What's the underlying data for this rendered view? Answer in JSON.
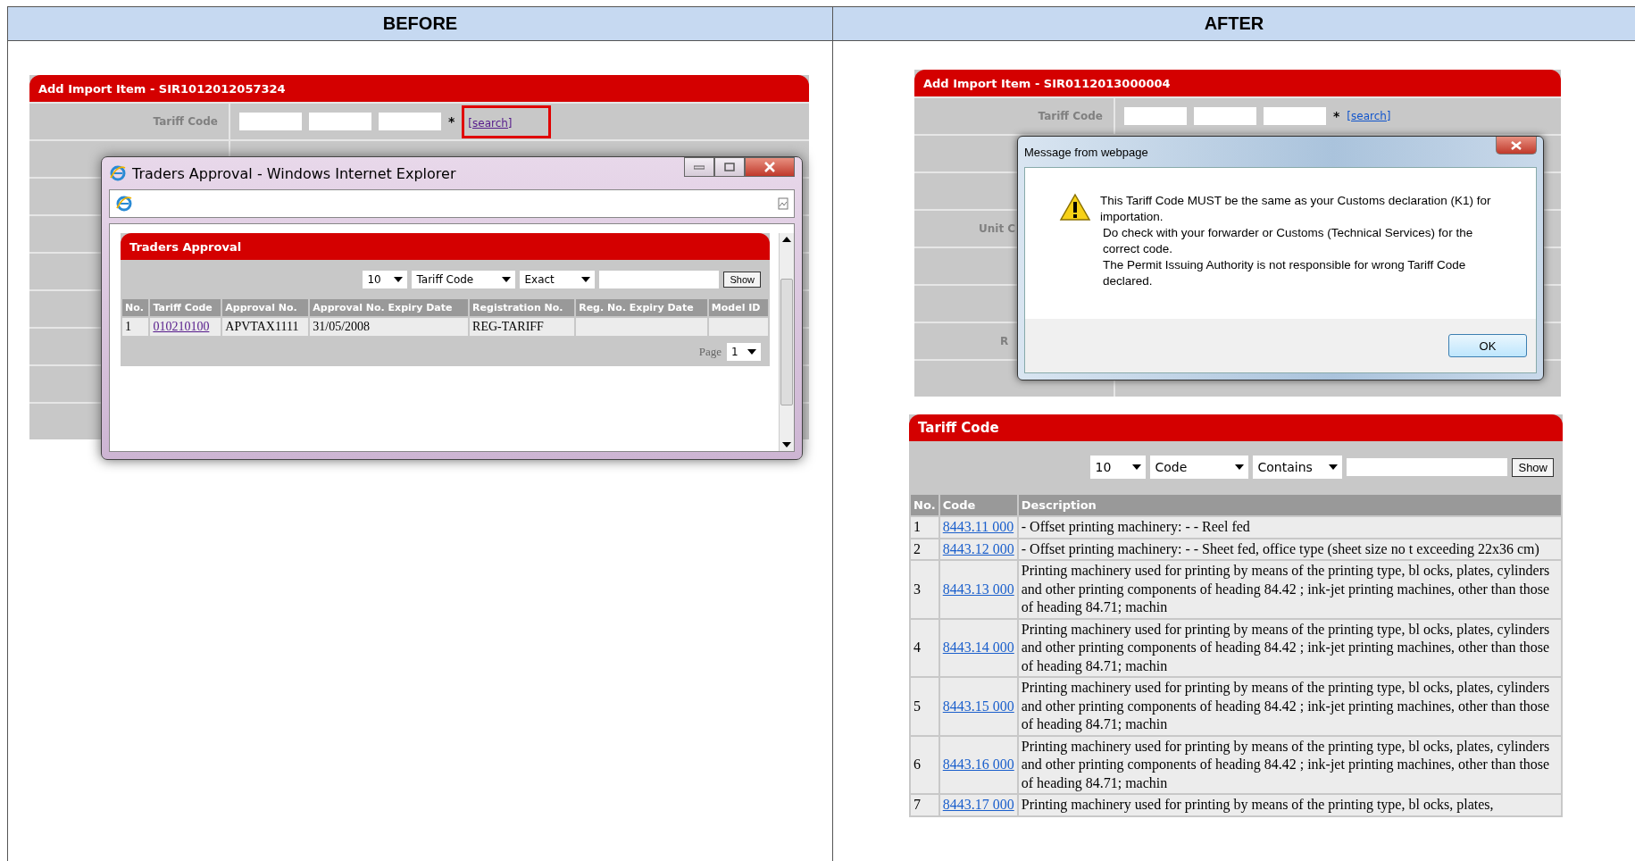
{
  "columns": [
    {
      "heading": "BEFORE"
    },
    {
      "heading": "AFTER"
    }
  ],
  "before": {
    "panel": {
      "title": "Add Import Item - SIR1012012057324",
      "tariff_label": "Tariff Code",
      "required_mark": "*",
      "search_link": "[search]",
      "search_highlighted": true
    },
    "popup": {
      "title": "Traders Approval - Windows Internet Explorer",
      "panel_title": "Traders Approval",
      "filters": {
        "page_size": "10",
        "field": "Tariff Code",
        "match": "Exact",
        "button": "Show"
      },
      "columns": [
        "No.",
        "Tariff Code",
        "Approval No.",
        "Approval No. Expiry Date",
        "Registration No.",
        "Reg. No. Expiry Date",
        "Model ID"
      ],
      "rows": [
        [
          "1",
          "010210100",
          "APVTAX1111",
          "31/05/2008",
          "REG-TARIFF"
        ]
      ],
      "pager": {
        "label": "Page",
        "value": "1"
      }
    }
  },
  "after": {
    "panel": {
      "title": "Add Import Item - SIR0112013000004",
      "tariff_label": "Tariff Code",
      "required_mark": "*",
      "search_link": "[search]",
      "search_highlighted": false,
      "covered_labels": [
        "Unit C",
        "R"
      ]
    },
    "dialog": {
      "title": "Message from webpage",
      "message": [
        "This Tariff Code MUST be the same as your Customs declaration (K1) for importation.",
        "Do check with your forwarder or Customs (Technical Services) for the correct code.",
        "The Permit Issuing Authority is not responsible for wrong Tariff Code declared."
      ],
      "button": "OK"
    },
    "tariff": {
      "title": "Tariff Code",
      "filters": {
        "page_size": "10",
        "field": "Code",
        "match": "Contains",
        "button": "Show"
      },
      "columns": [
        "No.",
        "Code",
        "Description"
      ],
      "rows": [
        [
          "1",
          "8443.11 000",
          "- Offset printing machinery: - - Reel fed"
        ],
        [
          "2",
          "8443.12 000",
          "- Offset printing machinery: - - Sheet fed, office type (sheet size no t exceeding 22x36 cm)"
        ],
        [
          "3",
          "8443.13 000",
          "Printing machinery used for printing by means of the printing type, bl ocks, plates, cylinders and other printing components of heading 84.42 ; ink-jet printing machines, other than those of heading 84.71; machin"
        ],
        [
          "4",
          "8443.14 000",
          "Printing machinery used for printing by means of the printing type, bl ocks, plates, cylinders and other printing components of heading 84.42 ; ink-jet printing machines, other than those of heading 84.71; machin"
        ],
        [
          "5",
          "8443.15 000",
          "Printing machinery used for printing by means of the printing type, bl ocks, plates, cylinders and other printing components of heading 84.42 ; ink-jet printing machines, other than those of heading 84.71; machin"
        ],
        [
          "6",
          "8443.16 000",
          "Printing machinery used for printing by means of the printing type, bl ocks, plates, cylinders and other printing components of heading 84.42 ; ink-jet printing machines, other than those of heading 84.71; machin"
        ],
        [
          "7",
          "8443.17 000",
          "Printing machinery used for printing by means of the printing type, bl ocks, plates,"
        ]
      ]
    }
  }
}
